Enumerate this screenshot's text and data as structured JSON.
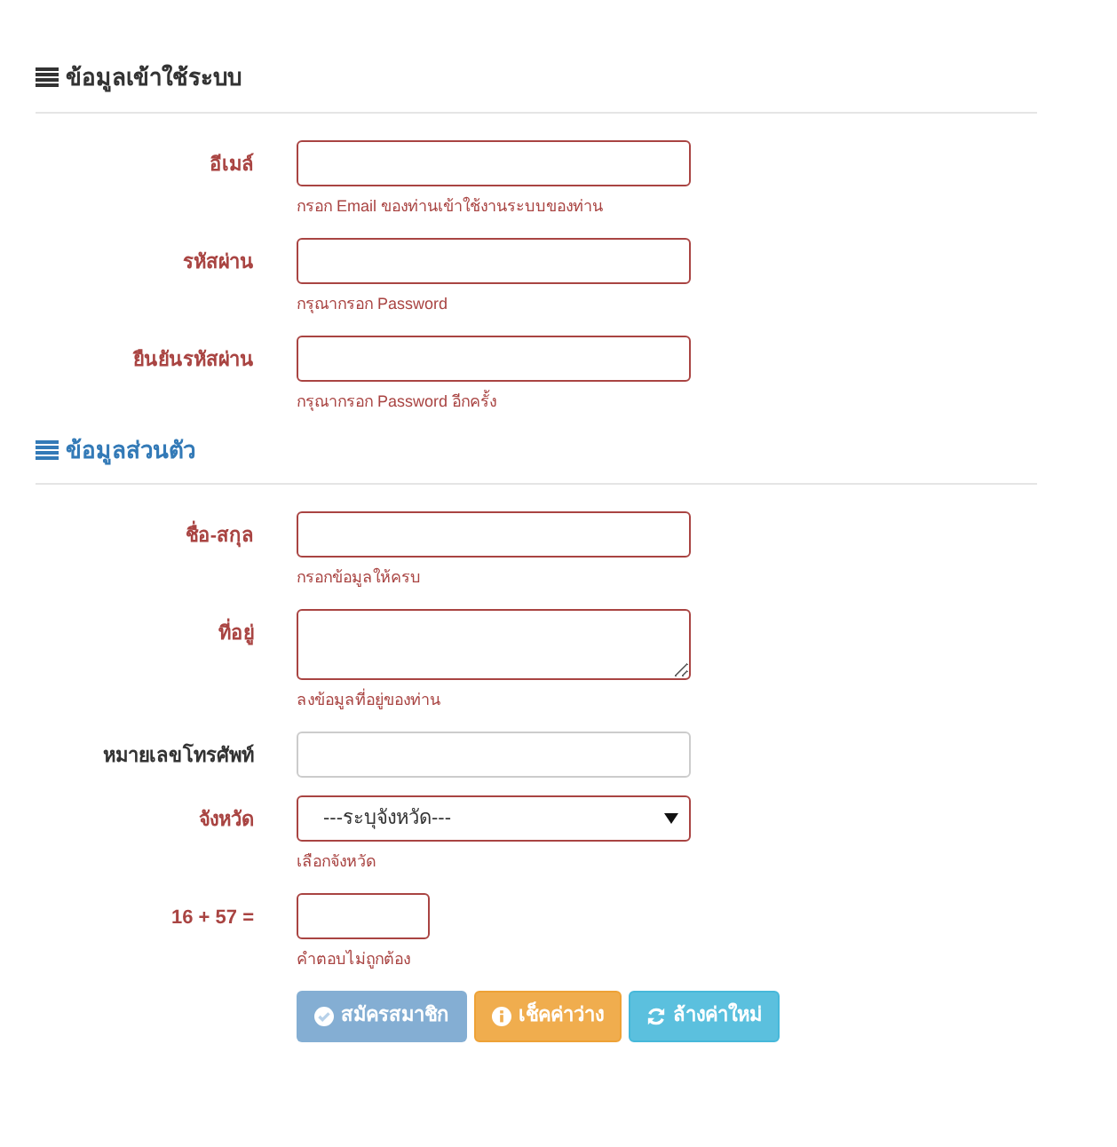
{
  "sections": [
    {
      "title": "ข้อมูลเข้าใช้ระบบ",
      "color": "#333333",
      "fields": [
        {
          "label": "อีเมล์",
          "kind": "input",
          "error": true,
          "help": "กรอก Email ของท่านเข้าใช้งานระบบของท่าน"
        },
        {
          "label": "รหัสผ่าน",
          "kind": "input",
          "error": true,
          "help": "กรุณากรอก Password"
        },
        {
          "label": "ยืนยันรหัสผ่าน",
          "kind": "input",
          "error": true,
          "help": "กรุณากรอก Password อีกครั้ง"
        }
      ]
    },
    {
      "title": "ข้อมูลส่วนตัว",
      "color": "#337ab7",
      "fields": [
        {
          "label": "ชื่อ-สกุล",
          "kind": "input",
          "error": true,
          "help": "กรอกข้อมูลให้ครบ"
        },
        {
          "label": "ที่อยู่",
          "kind": "textarea",
          "error": true,
          "help": "ลงข้อมูลที่อยู่ของท่าน"
        },
        {
          "label": "หมายเลขโทรศัพท์",
          "kind": "input",
          "error": false
        },
        {
          "label": "จังหวัด",
          "kind": "select",
          "error": true,
          "value": "---ระบุจังหวัด---",
          "help": "เลือกจังหวัด"
        },
        {
          "label": "16 + 57 =",
          "kind": "short-input",
          "error": true,
          "help": "คำตอบไม่ถูกต้อง"
        }
      ]
    }
  ],
  "buttons": [
    {
      "label": "สมัครสมาชิก",
      "kind": "submit",
      "disabled": true
    },
    {
      "label": "เช็คค่าว่าง",
      "kind": "check",
      "disabled": false
    },
    {
      "label": "ล้างค่าใหม่",
      "kind": "reset",
      "disabled": false
    }
  ]
}
